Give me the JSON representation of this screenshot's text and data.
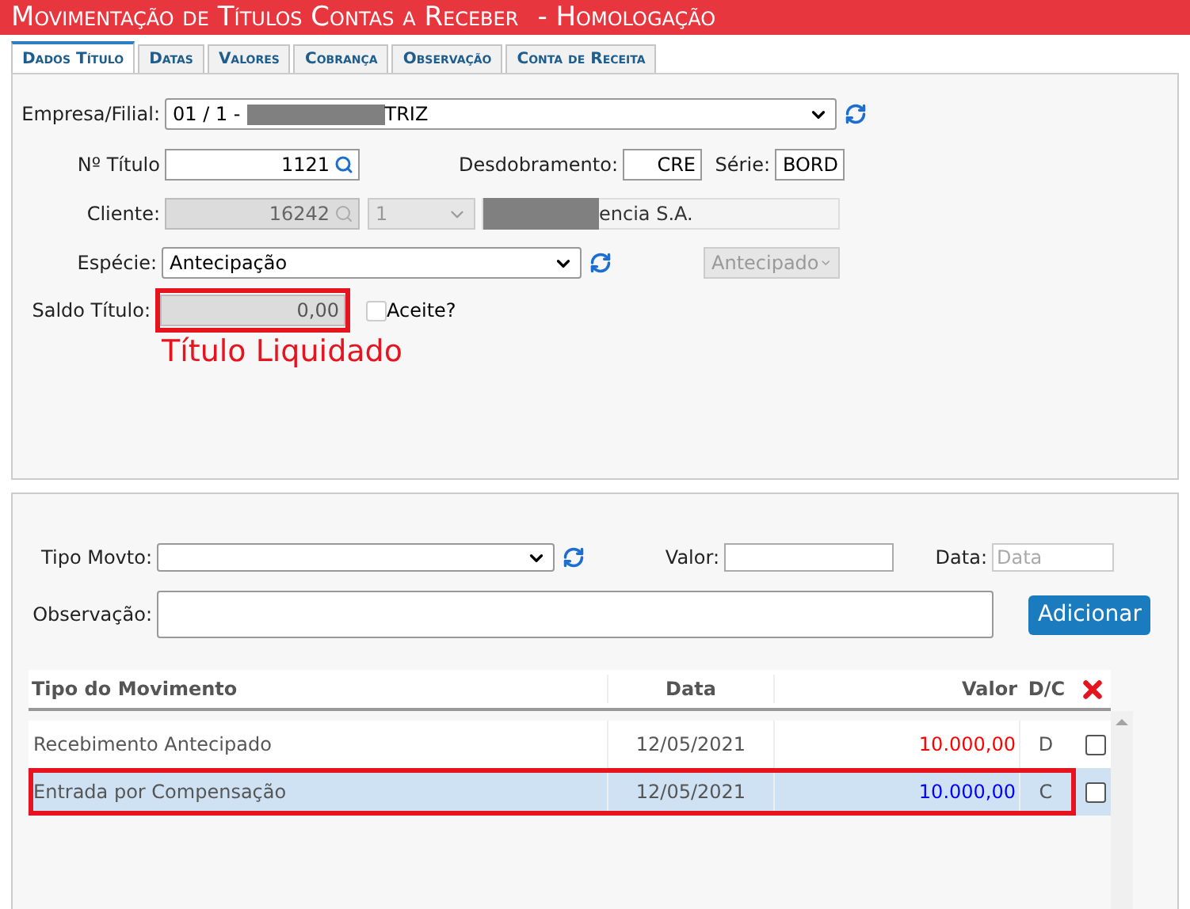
{
  "window": {
    "title": "Movimentação de Títulos Contas a Receber",
    "environment": "- Homologação"
  },
  "tabs": [
    {
      "label": "Dados Título",
      "selected": true
    },
    {
      "label": "Datas",
      "selected": false
    },
    {
      "label": "Valores",
      "selected": false
    },
    {
      "label": "Cobrança",
      "selected": false
    },
    {
      "label": "Observação",
      "selected": false
    },
    {
      "label": "Conta de Receita",
      "selected": false
    }
  ],
  "form": {
    "empresa": {
      "label": "Empresa/Filial:",
      "value_start": "01 / 1 -",
      "value_end": "TRIZ"
    },
    "titulo": {
      "label": "Nº Título",
      "value": "1121"
    },
    "desdobramento": {
      "label": "Desdobramento:",
      "value": "CRE"
    },
    "serie": {
      "label": "Série:",
      "value": "BORD"
    },
    "cliente": {
      "label": "Cliente:",
      "code": "16242",
      "branch": "1",
      "name_end": "encia S.A."
    },
    "especie": {
      "label": "Espécie:",
      "value": "Antecipação",
      "status": "Antecipado"
    },
    "saldo": {
      "label": "Saldo Título:",
      "value": "0,00",
      "highlighted": true
    },
    "aceite": {
      "label": "Aceite?",
      "checked": false
    },
    "annotation": "Título Liquidado"
  },
  "movimento": {
    "tipo": {
      "label": "Tipo Movto:"
    },
    "valor": {
      "label": "Valor:"
    },
    "data": {
      "label": "Data:",
      "placeholder": "Data"
    },
    "observacao": {
      "label": "Observação:"
    },
    "add_button": "Adicionar"
  },
  "table": {
    "columns": [
      "Tipo do Movimento",
      "Data",
      "Valor",
      "D/C"
    ],
    "rows": [
      {
        "tipo": "Recebimento Antecipado",
        "data": "12/05/2021",
        "valor": "10.000,00",
        "dc": "D",
        "color": "#ff0000",
        "selected": false,
        "highlighted": false,
        "checked": false
      },
      {
        "tipo": "Entrada por Compensação",
        "data": "12/05/2021",
        "valor": "10.000,00",
        "dc": "C",
        "color": "#0000ff",
        "selected": true,
        "highlighted": true,
        "checked": false
      }
    ]
  }
}
